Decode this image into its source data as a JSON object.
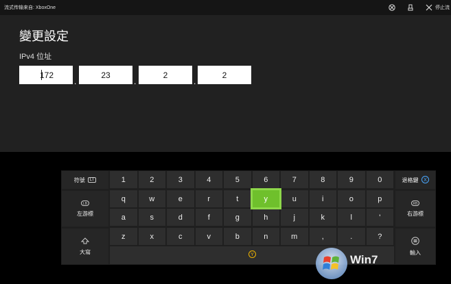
{
  "titlebar": {
    "title": "流式传输来自: XboxOne",
    "stop_label": "停止流"
  },
  "page": {
    "heading": "變更設定",
    "sublabel": "IPv4 位址"
  },
  "ip": {
    "fields": [
      "172",
      "23",
      "2",
      "2"
    ],
    "separators": [
      ".",
      ".",
      "."
    ]
  },
  "keyboard": {
    "left": {
      "symbols": "符號",
      "lt": "LT",
      "move_left": "左游標",
      "caps": "大寫"
    },
    "right": {
      "backspace": "退格鍵",
      "move_right": "右游標",
      "enter": "輸入"
    },
    "rows": [
      [
        "1",
        "2",
        "3",
        "4",
        "5",
        "6",
        "7",
        "8",
        "9",
        "0"
      ],
      [
        "q",
        "w",
        "e",
        "r",
        "t",
        "y",
        "u",
        "i",
        "o",
        "p"
      ],
      [
        "a",
        "s",
        "d",
        "f",
        "g",
        "h",
        "j",
        "k",
        "l",
        "'"
      ],
      [
        "z",
        "x",
        "c",
        "v",
        "b",
        "n",
        "m",
        ",",
        ".",
        "?"
      ]
    ],
    "selected_key": "y",
    "space_hint": "Y",
    "colors": {
      "selected": "#6fc02c",
      "key": "#2e2e2e"
    }
  },
  "watermark": {
    "text": "Win7"
  }
}
